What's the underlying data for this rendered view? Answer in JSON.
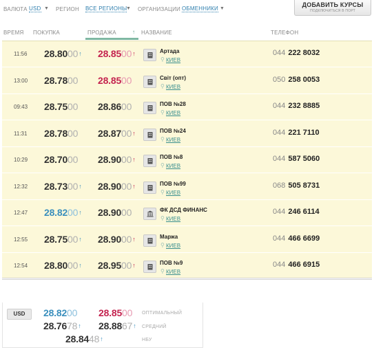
{
  "filters": {
    "currency_label": "ВАЛЮТА",
    "currency_value": "USD",
    "region_label": "РЕГИОН",
    "region_value": "ВСЕ РЕГИОНЫ",
    "org_label": "ОРГАНИЗАЦИИ",
    "org_value": "ОБМЕННИКИ"
  },
  "add_button": {
    "title": "ДОБАВИТЬ КУРСЫ",
    "subtitle": "ПОДКЛЮЧИТЬСЯ В ПОРТ"
  },
  "columns": {
    "time": "ВРЕМЯ",
    "buy": "ПОКУПКА",
    "sell": "ПРОДАЖА",
    "name": "НАЗВАНИЕ",
    "phone": "ТЕЛЕФОН"
  },
  "icons": {
    "sort": "sort-up-arrow-icon",
    "office": "office-icon",
    "bank": "bank-icon",
    "pin": "location-pin-icon"
  },
  "colors": {
    "best_buy": "#3a8fbd",
    "best_sell": "#c4234f",
    "row_bg": "#fcf8d9"
  },
  "rows": [
    {
      "time": "11:56",
      "buy_main": "28.80",
      "buy_tail": "00",
      "buy_arrow": "↑",
      "buy_best": false,
      "sell_main": "28.85",
      "sell_tail": "00",
      "sell_arrow": "↑",
      "sell_best": true,
      "icon": "office",
      "name": "Артада",
      "city": "КИЕВ",
      "phone_code": "044",
      "phone_number": "222 8032"
    },
    {
      "time": "13:00",
      "buy_main": "28.78",
      "buy_tail": "00",
      "buy_arrow": "",
      "buy_best": false,
      "sell_main": "28.85",
      "sell_tail": "00",
      "sell_arrow": "",
      "sell_best": true,
      "icon": "office",
      "name": "Світ (опт)",
      "city": "КИЕВ",
      "phone_code": "050",
      "phone_number": "258 0053"
    },
    {
      "time": "09:43",
      "buy_main": "28.75",
      "buy_tail": "00",
      "buy_arrow": "",
      "buy_best": false,
      "sell_main": "28.86",
      "sell_tail": "00",
      "sell_arrow": "",
      "sell_best": false,
      "icon": "office",
      "name": "ПОВ №28",
      "city": "КИЕВ",
      "phone_code": "044",
      "phone_number": "232 8885"
    },
    {
      "time": "11:31",
      "buy_main": "28.78",
      "buy_tail": "00",
      "buy_arrow": "",
      "buy_best": false,
      "sell_main": "28.87",
      "sell_tail": "00",
      "sell_arrow": "↑",
      "sell_best": false,
      "icon": "office",
      "name": "ПОВ №24",
      "city": "КИЕВ",
      "phone_code": "044",
      "phone_number": "221 7110"
    },
    {
      "time": "10:29",
      "buy_main": "28.70",
      "buy_tail": "00",
      "buy_arrow": "",
      "buy_best": false,
      "sell_main": "28.90",
      "sell_tail": "00",
      "sell_arrow": "↑",
      "sell_best": false,
      "icon": "office",
      "name": "ПОВ №8",
      "city": "КИЕВ",
      "phone_code": "044",
      "phone_number": "587 5060"
    },
    {
      "time": "12:32",
      "buy_main": "28.73",
      "buy_tail": "00",
      "buy_arrow": "↑",
      "buy_best": false,
      "sell_main": "28.90",
      "sell_tail": "00",
      "sell_arrow": "↑",
      "sell_best": false,
      "icon": "office",
      "name": "ПОВ №99",
      "city": "КИЕВ",
      "phone_code": "068",
      "phone_number": "505 8731"
    },
    {
      "time": "12:47",
      "buy_main": "28.82",
      "buy_tail": "00",
      "buy_arrow": "↑",
      "buy_best": true,
      "sell_main": "28.90",
      "sell_tail": "00",
      "sell_arrow": "",
      "sell_best": false,
      "icon": "bank",
      "name": "ФК ДСД ФИНАНС",
      "city": "КИЕВ",
      "phone_code": "044",
      "phone_number": "246 6114"
    },
    {
      "time": "12:55",
      "buy_main": "28.75",
      "buy_tail": "00",
      "buy_arrow": "↑",
      "buy_best": false,
      "sell_main": "28.90",
      "sell_tail": "00",
      "sell_arrow": "↑",
      "sell_best": false,
      "icon": "office",
      "name": "Маржа",
      "city": "КИЕВ",
      "phone_code": "044",
      "phone_number": "466 6699"
    },
    {
      "time": "12:54",
      "buy_main": "28.80",
      "buy_tail": "00",
      "buy_arrow": "↑",
      "buy_best": false,
      "sell_main": "28.95",
      "sell_tail": "00",
      "sell_arrow": "↑",
      "sell_best": false,
      "icon": "office",
      "name": "ПОВ №9",
      "city": "КИЕВ",
      "phone_code": "044",
      "phone_number": "466 6915"
    }
  ],
  "summary": {
    "currency": "USD",
    "optimal": {
      "label": "ОПТИМАЛЬНЫЙ",
      "buy_main": "28.82",
      "buy_tail": "00",
      "sell_main": "28.85",
      "sell_tail": "00"
    },
    "average": {
      "label": "СРЕДНИЙ",
      "buy_main": "28.76",
      "buy_tail": "78",
      "buy_arrow": "↑",
      "sell_main": "28.88",
      "sell_tail": "67",
      "sell_arrow": "↑"
    },
    "nbu": {
      "label": "НБУ",
      "main": "28.84",
      "tail": "48",
      "arrow": "↑"
    }
  }
}
